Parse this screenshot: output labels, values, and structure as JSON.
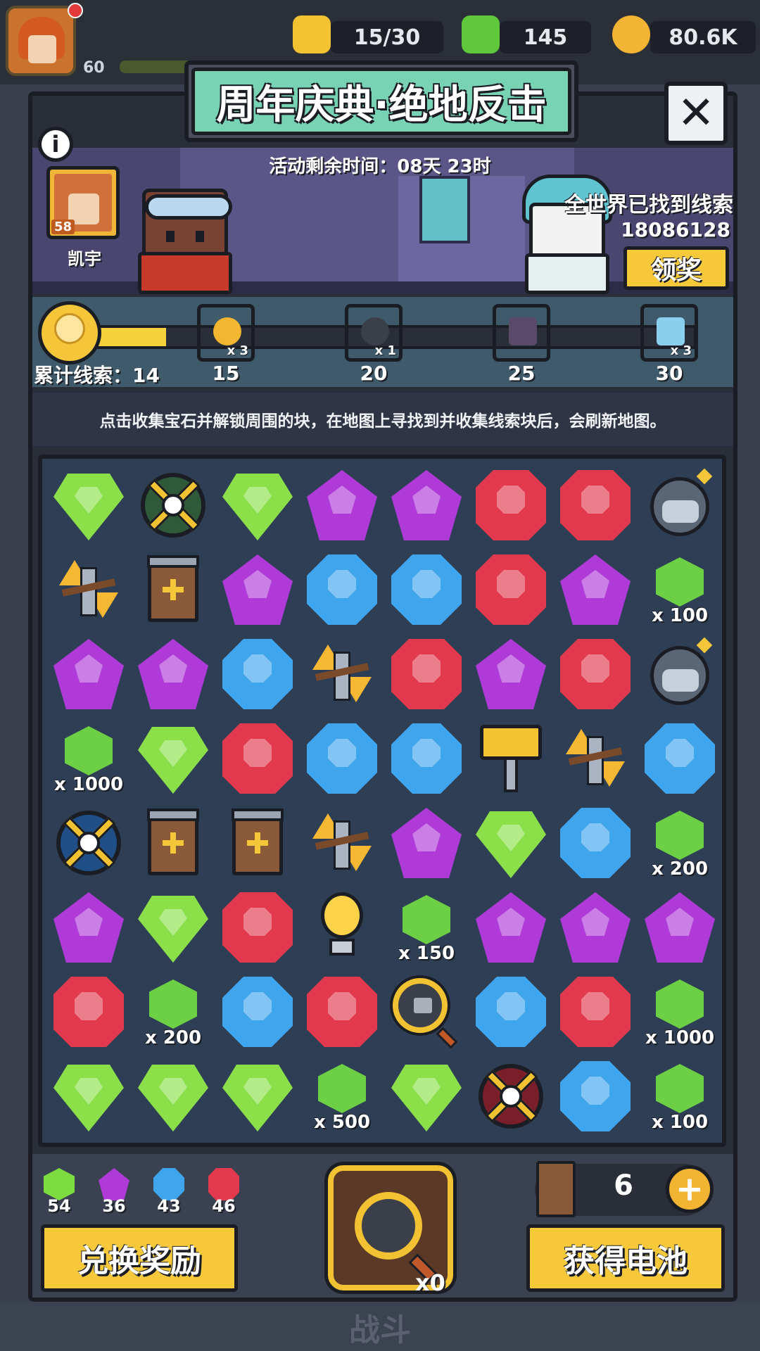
{
  "topbar": {
    "level": "60",
    "energy": "15/30",
    "gems": "145",
    "coins": "80.6K"
  },
  "modal": {
    "title": "周年庆典·绝地反击",
    "close_label": "✕",
    "info_label": "i",
    "event_time_label": "活动剩余时间：",
    "event_time_value": "08天 23时",
    "player_name": "凯宇",
    "player_level": "58",
    "world_clue_title": "全世界已找到线索",
    "world_clue_count": "18086128",
    "claim_label": "领奖"
  },
  "progress": {
    "total_label": "累计线索：",
    "total_value": "14",
    "fill_fraction": 0.12,
    "milestones": [
      {
        "value": "15",
        "qty": "x 3",
        "icon": "key-icon",
        "color": "#b33ad6"
      },
      {
        "value": "20",
        "qty": "x 1",
        "icon": "lock-icon",
        "color": "#f2b630"
      },
      {
        "value": "25",
        "qty": "",
        "icon": "boot-icon",
        "color": "#b33ad6"
      },
      {
        "value": "30",
        "qty": "x 3",
        "icon": "card-key-icon",
        "color": "#f2b630"
      }
    ]
  },
  "instructions": "点击收集宝石并解锁周围的块，在地图上寻找到并收集线索块后，会刷新地图。",
  "board": {
    "rows": [
      [
        {
          "t": "green"
        },
        {
          "t": "cross-green"
        },
        {
          "t": "green"
        },
        {
          "t": "purple"
        },
        {
          "t": "purple"
        },
        {
          "t": "red"
        },
        {
          "t": "red"
        },
        {
          "t": "bomb"
        }
      ],
      [
        {
          "t": "arrows"
        },
        {
          "t": "battery"
        },
        {
          "t": "purple"
        },
        {
          "t": "blue"
        },
        {
          "t": "blue"
        },
        {
          "t": "red"
        },
        {
          "t": "purple"
        },
        {
          "t": "smallgem",
          "q": "x 100"
        }
      ],
      [
        {
          "t": "purple"
        },
        {
          "t": "purple"
        },
        {
          "t": "blue"
        },
        {
          "t": "arrows"
        },
        {
          "t": "red"
        },
        {
          "t": "purple"
        },
        {
          "t": "red"
        },
        {
          "t": "bomb"
        }
      ],
      [
        {
          "t": "smallgem",
          "q": "x 1000"
        },
        {
          "t": "green"
        },
        {
          "t": "red"
        },
        {
          "t": "blue"
        },
        {
          "t": "blue"
        },
        {
          "t": "hammer"
        },
        {
          "t": "arrows"
        },
        {
          "t": "blue"
        }
      ],
      [
        {
          "t": "cross-blue"
        },
        {
          "t": "battery"
        },
        {
          "t": "battery"
        },
        {
          "t": "arrows"
        },
        {
          "t": "purple"
        },
        {
          "t": "green"
        },
        {
          "t": "blue"
        },
        {
          "t": "smallgem",
          "q": "x 200"
        }
      ],
      [
        {
          "t": "purple"
        },
        {
          "t": "green"
        },
        {
          "t": "red"
        },
        {
          "t": "bulb"
        },
        {
          "t": "smallgem",
          "q": "x 150"
        },
        {
          "t": "purple"
        },
        {
          "t": "purple"
        },
        {
          "t": "purple"
        }
      ],
      [
        {
          "t": "red"
        },
        {
          "t": "smallgem",
          "q": "x 200"
        },
        {
          "t": "blue"
        },
        {
          "t": "red"
        },
        {
          "t": "magnifier"
        },
        {
          "t": "blue"
        },
        {
          "t": "red"
        },
        {
          "t": "smallgem",
          "q": "x 1000"
        }
      ],
      [
        {
          "t": "green"
        },
        {
          "t": "green"
        },
        {
          "t": "green"
        },
        {
          "t": "smallgem",
          "q": "x 500"
        },
        {
          "t": "green"
        },
        {
          "t": "cross-red"
        },
        {
          "t": "blue"
        },
        {
          "t": "smallgem",
          "q": "x 100"
        }
      ]
    ]
  },
  "inventory": {
    "green": "54",
    "purple": "36",
    "blue": "43",
    "red": "46",
    "dig_count": "x0",
    "battery_count": "6"
  },
  "buttons": {
    "exchange": "兑换奖励",
    "get_battery": "获得电池",
    "plus": "+"
  },
  "nav": {
    "battle": "战斗"
  }
}
